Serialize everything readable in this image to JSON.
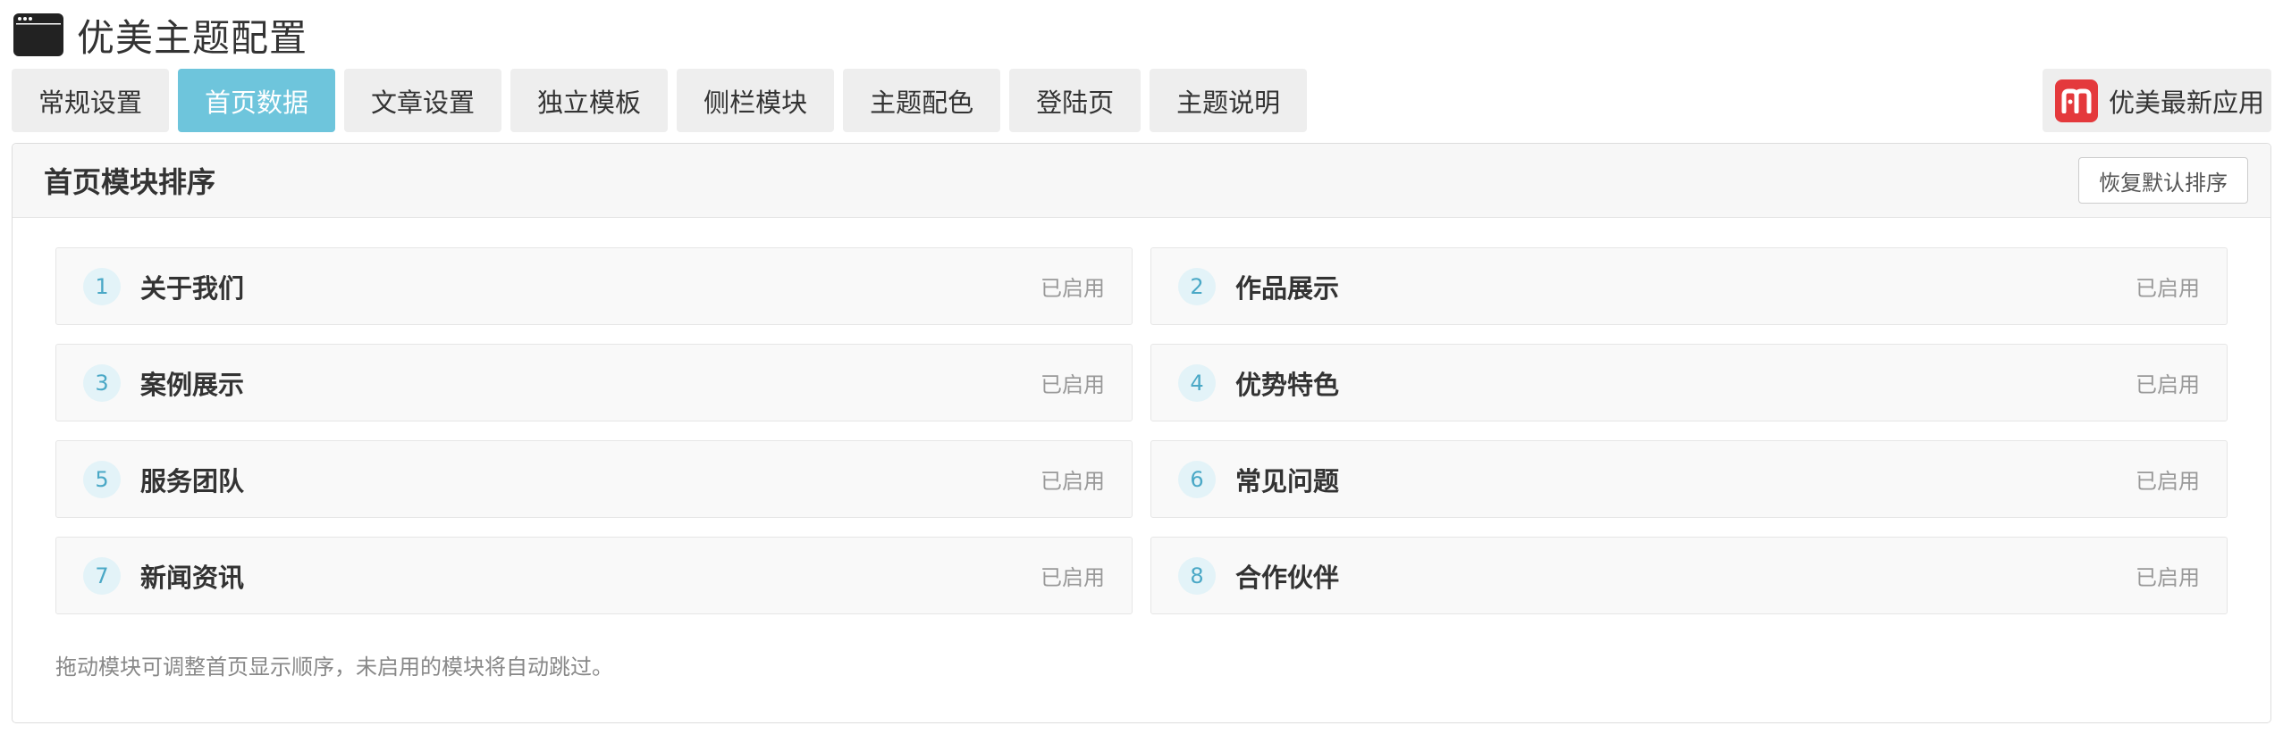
{
  "header": {
    "title": "优美主题配置",
    "icon": "window-icon"
  },
  "tabs": [
    {
      "label": "常规设置",
      "active": false
    },
    {
      "label": "首页数据",
      "active": true
    },
    {
      "label": "文章设置",
      "active": false
    },
    {
      "label": "独立模板",
      "active": false
    },
    {
      "label": "侧栏模块",
      "active": false
    },
    {
      "label": "主题配色",
      "active": false
    },
    {
      "label": "登陆页",
      "active": false
    },
    {
      "label": "主题说明",
      "active": false
    }
  ],
  "apps_button": {
    "label": "优美最新应用",
    "icon": "brand-logo-icon"
  },
  "panel": {
    "title": "首页模块排序",
    "reset_label": "恢复默认排序",
    "modules": [
      {
        "num": "1",
        "name": "关于我们",
        "status": "已启用"
      },
      {
        "num": "2",
        "name": "作品展示",
        "status": "已启用"
      },
      {
        "num": "3",
        "name": "案例展示",
        "status": "已启用"
      },
      {
        "num": "4",
        "name": "优势特色",
        "status": "已启用"
      },
      {
        "num": "5",
        "name": "服务团队",
        "status": "已启用"
      },
      {
        "num": "6",
        "name": "常见问题",
        "status": "已启用"
      },
      {
        "num": "7",
        "name": "新闻资讯",
        "status": "已启用"
      },
      {
        "num": "8",
        "name": "合作伙伴",
        "status": "已启用"
      }
    ],
    "hint": "拖动模块可调整首页显示顺序，未启用的模块将自动跳过。"
  },
  "colors": {
    "accent": "#6ec5dc",
    "brand": "#e4393c",
    "tab_bg": "#eeeeee"
  }
}
